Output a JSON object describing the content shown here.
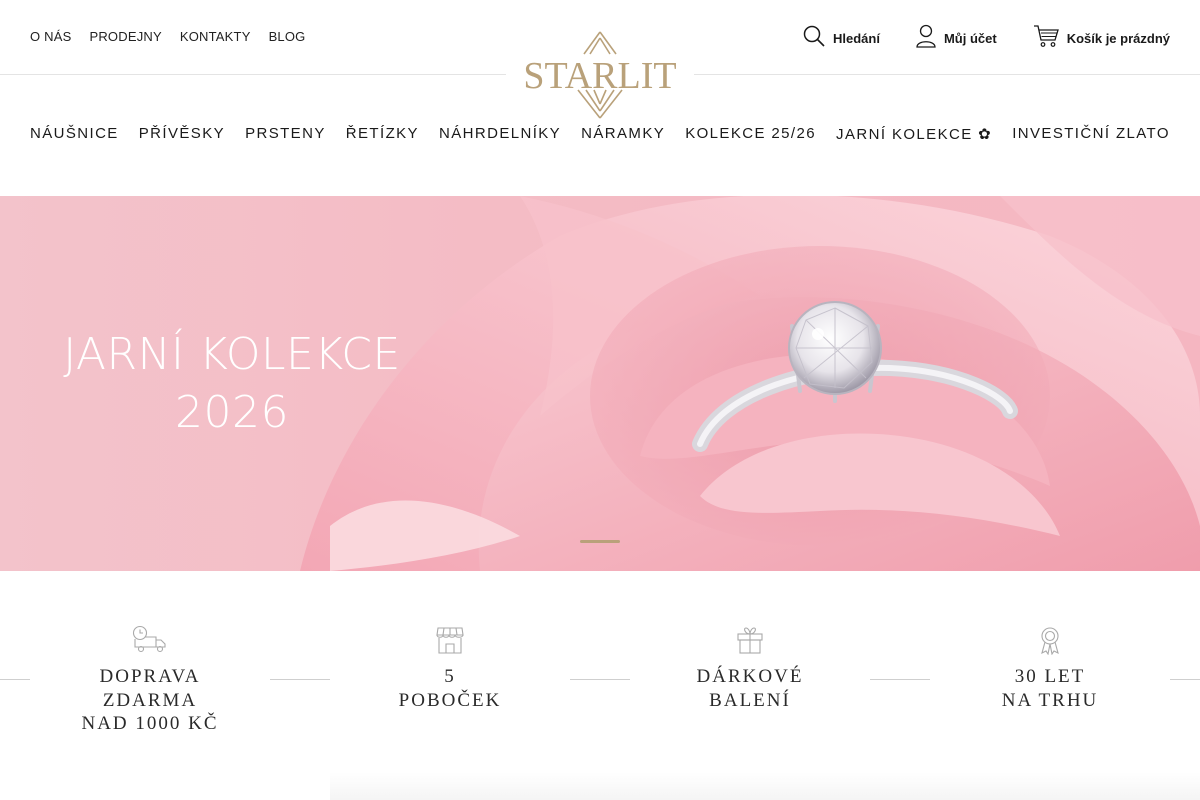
{
  "header": {
    "top_links": [
      {
        "label": "O NÁS"
      },
      {
        "label": "PRODEJNY"
      },
      {
        "label": "KONTAKTY"
      },
      {
        "label": "BLOG"
      }
    ],
    "logo_text": "STARLIT",
    "search_label": "Hledání",
    "account_label": "Můj účet",
    "cart_label": "Košík je prázdný"
  },
  "nav": {
    "items": [
      {
        "label": "NÁUŠNICE"
      },
      {
        "label": "PŘÍVĚSKY"
      },
      {
        "label": "PRSTENY"
      },
      {
        "label": "ŘETÍZKY"
      },
      {
        "label": "NÁHRDELNÍKY"
      },
      {
        "label": "NÁRAMKY"
      },
      {
        "label": "KOLEKCE 25/26"
      },
      {
        "label": "JARNÍ KOLEKCE ✿"
      },
      {
        "label": "INVESTIČNÍ ZLATO"
      }
    ]
  },
  "hero": {
    "title_line1": "JARNÍ KOLEKCE",
    "title_line2": "2026",
    "slide_count": 1,
    "active_slide": 1
  },
  "features": [
    {
      "icon": "delivery-truck-icon",
      "line1": "DOPRAVA",
      "line2": "ZDARMA",
      "line3": "NAD 1000 KČ"
    },
    {
      "icon": "store-icon",
      "line1": "5",
      "line2": "POBOČEK",
      "line3": ""
    },
    {
      "icon": "gift-icon",
      "line1": "DÁRKOVÉ",
      "line2": "BALENÍ",
      "line3": ""
    },
    {
      "icon": "award-ribbon-icon",
      "line1": "30 LET",
      "line2": "NA TRHU",
      "line3": ""
    }
  ],
  "colors": {
    "brand_gold": "#b9a17a",
    "hero_pink": "#f4bcc5",
    "text_dark": "#1a1a1a"
  }
}
